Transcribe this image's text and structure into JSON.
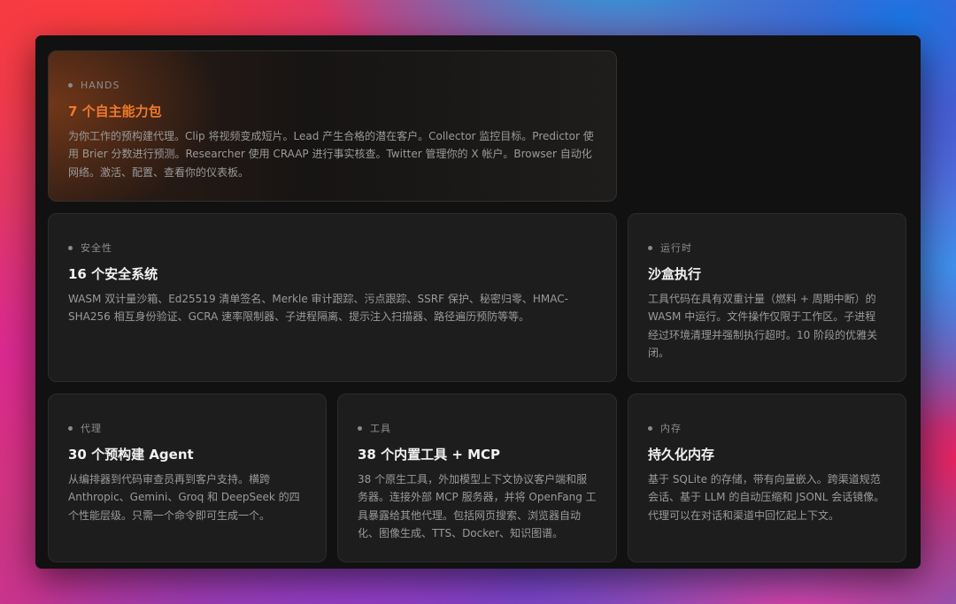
{
  "cards": [
    {
      "tag": "HANDS",
      "title": "7 个自主能力包",
      "desc": "为你工作的预构建代理。Clip 将视频变成短片。Lead 产生合格的潜在客户。Collector 监控目标。Predictor 使用 Brier 分数进行预测。Researcher 使用 CRAAP 进行事实核查。Twitter 管理你的 X 帐户。Browser 自动化网络。激活、配置、查看你的仪表板。"
    },
    {
      "tag": "安全性",
      "title": "16 个安全系统",
      "desc": "WASM 双计量沙箱、Ed25519 清单签名、Merkle 审计跟踪、污点跟踪、SSRF 保护、秘密归零、HMAC-SHA256 相互身份验证、GCRA 速率限制器、子进程隔离、提示注入扫描器、路径遍历预防等等。"
    },
    {
      "tag": "运行时",
      "title": "沙盒执行",
      "desc": "工具代码在具有双重计量（燃料 + 周期中断）的 WASM 中运行。文件操作仅限于工作区。子进程经过环境清理并强制执行超时。10 阶段的优雅关闭。"
    },
    {
      "tag": "代理",
      "title": "30 个预构建 Agent",
      "desc": "从编排器到代码审查员再到客户支持。横跨 Anthropic、Gemini、Groq 和 DeepSeek 的四个性能层级。只需一个命令即可生成一个。"
    },
    {
      "tag": "工具",
      "title": "38 个内置工具 + MCP",
      "desc": "38 个原生工具，外加模型上下文协议客户端和服务器。连接外部 MCP 服务器，并将 OpenFang 工具暴露给其他代理。包括网页搜索、浏览器自动化、图像生成、TTS、Docker、知识图谱。"
    },
    {
      "tag": "内存",
      "title": "持久化内存",
      "desc": "基于 SQLite 的存储，带有向量嵌入。跨渠道规范会话、基于 LLM 的自动压缩和 JSONL 会话镜像。代理可以在对话和渠道中回忆起上下文。"
    }
  ],
  "colors": {
    "accent": "#f2792a",
    "card_bg": "#1d1d1d",
    "window_bg": "#111111"
  }
}
